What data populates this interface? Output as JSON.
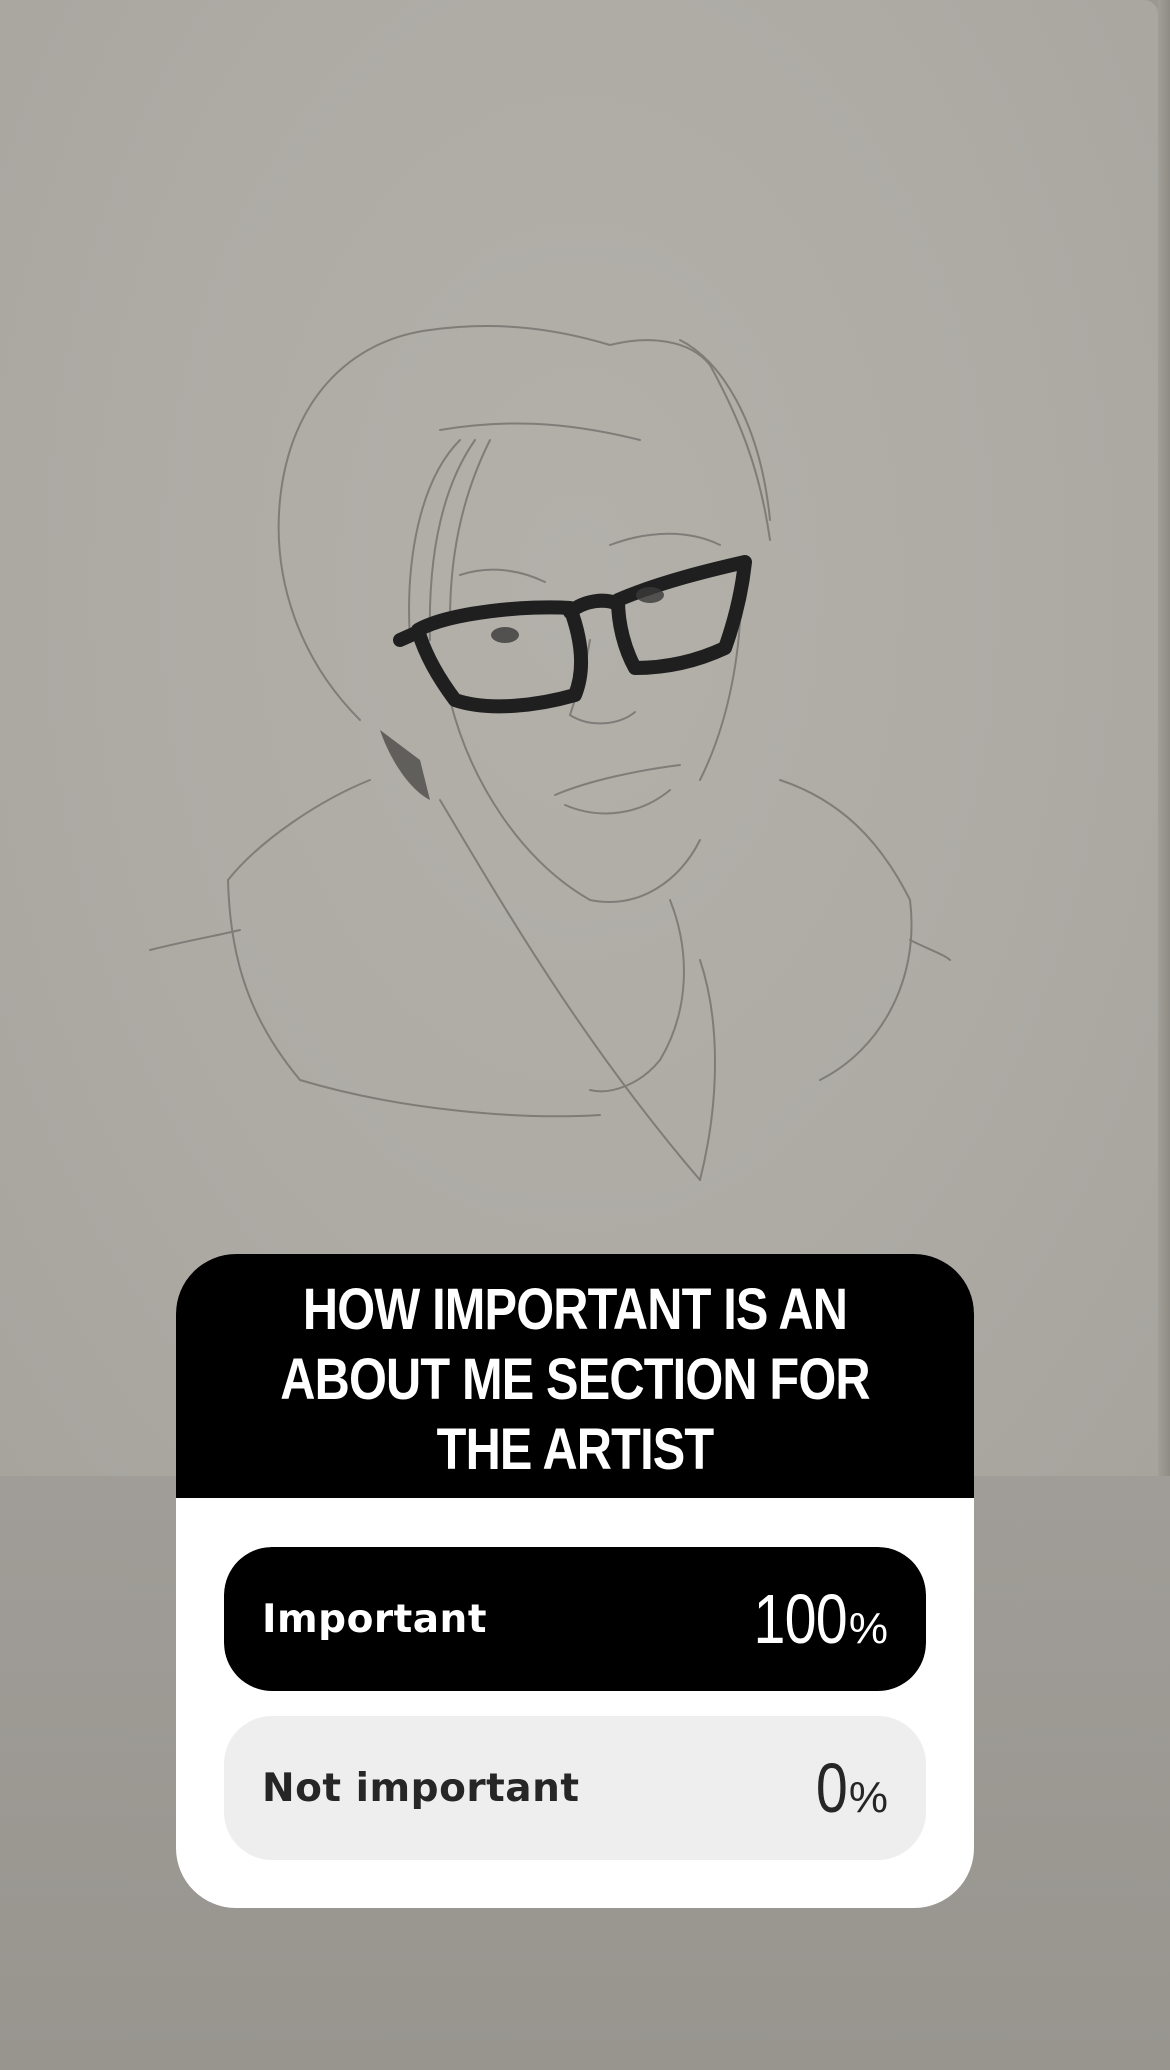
{
  "poll": {
    "question": "HOW IMPORTANT IS AN ABOUT ME SECTION FOR THE ARTIST",
    "options": [
      {
        "label": "Important",
        "percent_value": "100",
        "percent_sign": "%",
        "share": 1.0
      },
      {
        "label": "Not important",
        "percent_value": "0",
        "percent_sign": "%",
        "share": 0.0
      }
    ]
  },
  "colors": {
    "poll_header": "#000000",
    "winner_fill": "#000000",
    "option_track": "#eeeeee",
    "paper": "#aeaba5"
  }
}
